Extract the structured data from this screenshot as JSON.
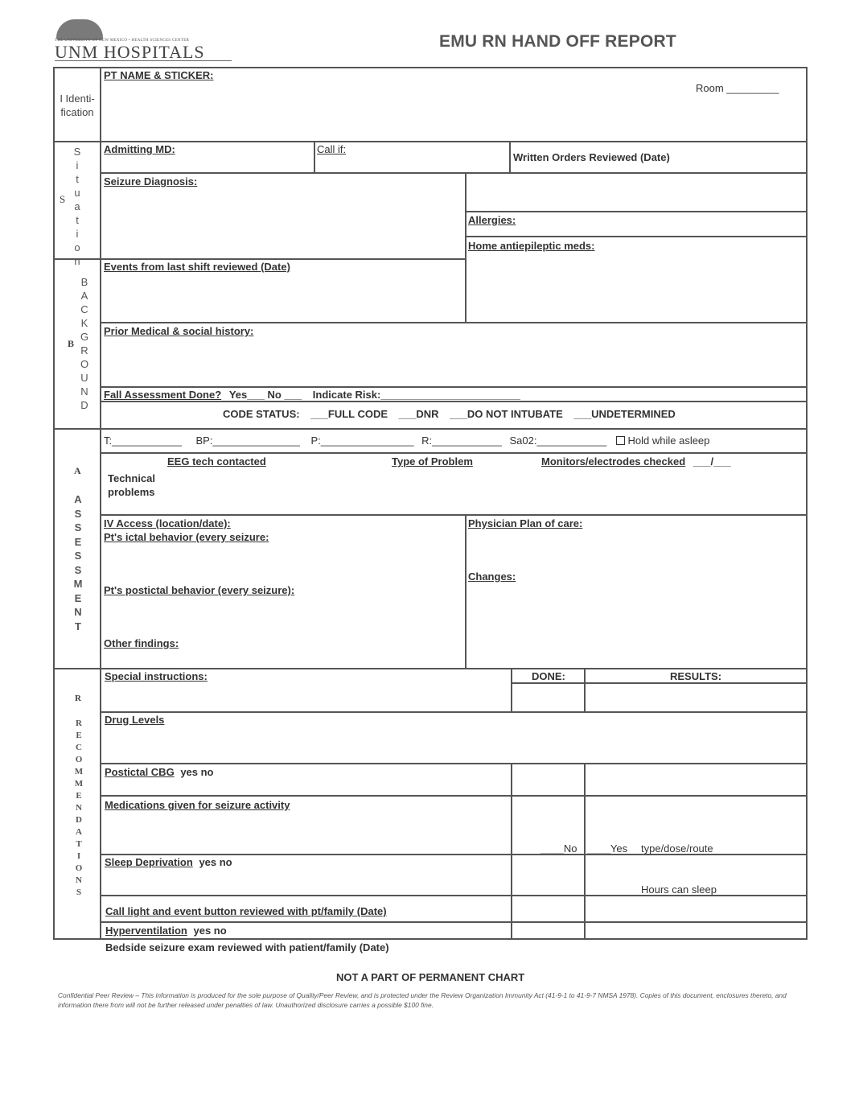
{
  "header": {
    "logo_subtitle": "THE UNIVERSITY OF NEW MEXICO • HEALTH SCIENCES CENTER",
    "logo_name": "UNM HOSPITALS",
    "title": "EMU RN HAND OFF REPORT"
  },
  "sections": {
    "identification": {
      "label": "I Identi-fication",
      "letter": "I"
    },
    "situation": {
      "letter": "S",
      "vertical": [
        "S",
        "i",
        "t",
        "u",
        "a",
        "t",
        "i",
        "o",
        "n"
      ]
    },
    "background": {
      "letter": "B",
      "vertical": [
        "B",
        "A",
        "C",
        "K",
        "G",
        "R",
        "O",
        "U",
        "N",
        "D"
      ]
    },
    "assessment": {
      "letter": "A",
      "vertical": [
        "A",
        "S",
        "S",
        "E",
        "S",
        "S",
        "M",
        "E",
        "N",
        "T"
      ]
    },
    "recommendations": {
      "letter": "R",
      "vertical": [
        "R",
        "E",
        "C",
        "O",
        "M",
        "M",
        "E",
        "N",
        "D",
        "A",
        "T",
        "I",
        "O",
        "N",
        "S"
      ]
    }
  },
  "fields": {
    "pt_name": "PT NAME & STICKER:",
    "room": "Room _________",
    "admitting_md": "Admitting MD:",
    "call_if": "Call if:",
    "written_orders": "Written Orders Reviewed (Date)",
    "seizure_diagnosis": "Seizure Diagnosis:",
    "allergies": "Allergies:",
    "home_meds": "Home antiepileptic meds:",
    "events_last_shift": "Events from last shift  reviewed (Date)",
    "prior_history": "Prior Medical & social history:",
    "fall_assessment": "Fall Assessment Done?",
    "fall_options": "Yes___  No ___",
    "indicate_risk": "Indicate Risk:________________________",
    "code_status_label": "CODE STATUS:",
    "code_status_options": [
      "___FULL CODE",
      "___DNR",
      "___DO NOT INTUBATE",
      "___UNDETERMINED"
    ],
    "vitals": [
      {
        "label": "T:____________"
      },
      {
        "label": "BP:_______________"
      },
      {
        "label": "P:________________"
      },
      {
        "label": "R:____________"
      },
      {
        "label": "Sa02:____________"
      }
    ],
    "hold_while_asleep": "Hold while asleep",
    "eeg_tech": "EEG tech contacted",
    "type_of_problem": "Type of Problem",
    "monitors_checked": "Monitors/electrodes checked",
    "monitors_blank": "___/___",
    "technical_problems": [
      "Technical",
      "problems"
    ],
    "iv_access": "IV Access (location/date):",
    "ictal_behavior": "Pt's ictal behavior (every seizure:",
    "postictal_behavior": "Pt's postictal behavior (every seizure):",
    "other_findings": "Other findings: ",
    "physician_plan": "Physician Plan of care:",
    "changes": "Changes:",
    "special_instructions": "Special instructions:",
    "done_header": "DONE:",
    "results_header": "RESULTS:",
    "drug_levels": "Drug Levels",
    "postictal_cbg": "Postictal CBG",
    "yes_no": "yes  no",
    "medications_given": "Medications given for seizure activity",
    "med_no": "____No",
    "med_yes": "____Yes",
    "med_type": "type/dose/route",
    "sleep_deprivation": "Sleep Deprivation",
    "hours_can_sleep": "Hours can sleep",
    "call_light": "Call light and event button reviewed with pt/family (Date)",
    "hyperventilation": "Hyperventilation",
    "bedside_exam": "Bedside seizure exam reviewed with patient/family (Date)"
  },
  "footer": {
    "title": "NOT A PART OF PERMANENT CHART",
    "note": "Confidential Peer Review – This information is produced for the sole purpose of Quality/Peer Review, and is protected under the Review Organization Immunity Act (41-9-1 to 41-9-7 NMSA 1978). Copies of this document, enclosures thereto, and information there from will not be further released under penalties of law. Unauthorized disclosure carries a possible $100 fine."
  }
}
